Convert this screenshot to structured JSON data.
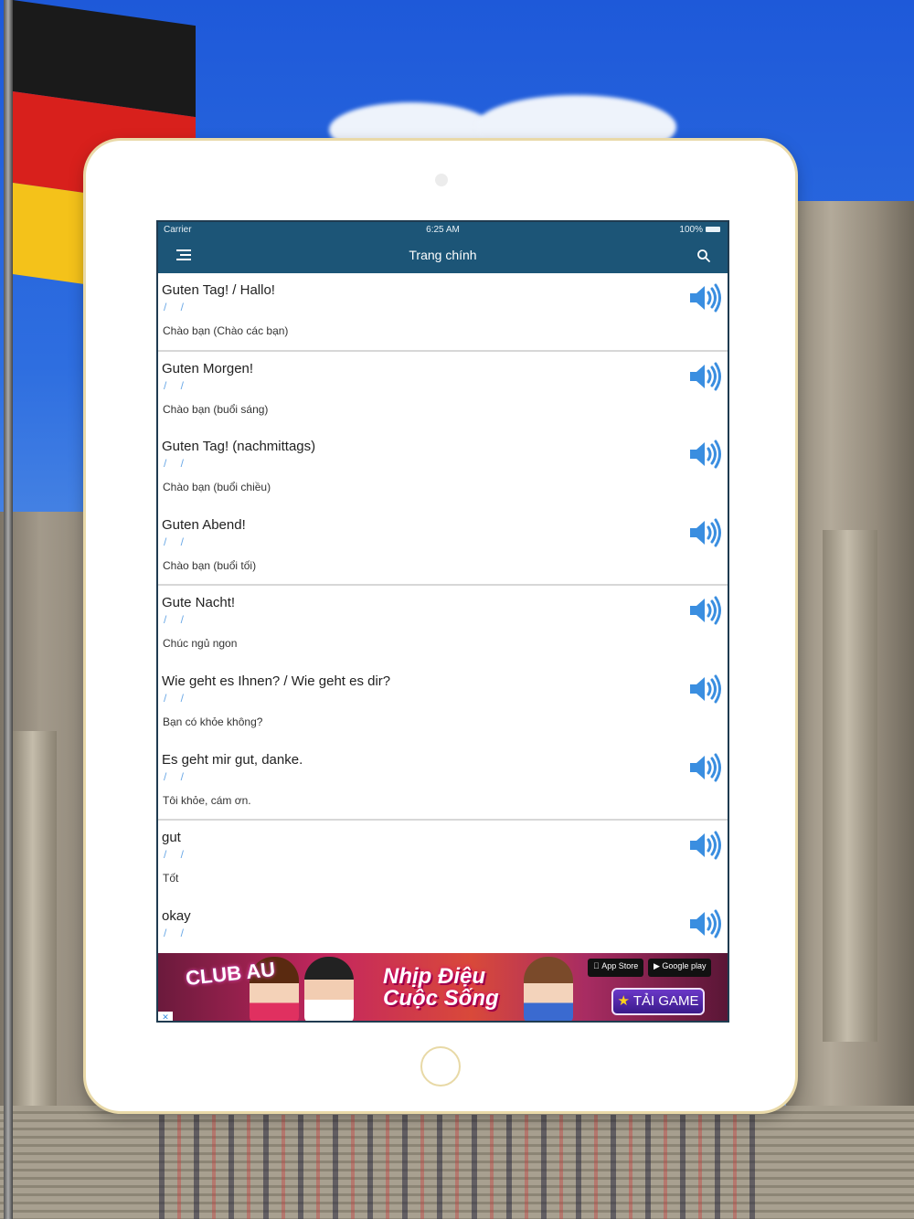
{
  "status_bar": {
    "carrier": "Carrier",
    "time": "6:25 AM",
    "battery": "100%"
  },
  "nav": {
    "title": "Trang chính"
  },
  "phrases": [
    {
      "german": "Guten Tag! / Hallo!",
      "phonetic": "/ /",
      "meaning": "Chào bạn (Chào các bạn)"
    },
    {
      "german": "Guten Morgen!",
      "phonetic": "/ /",
      "meaning": "Chào bạn (buổi sáng)"
    },
    {
      "german": "Guten Tag! (nachmittags)",
      "phonetic": "/ /",
      "meaning": "Chào bạn (buổi chiều)"
    },
    {
      "german": "Guten Abend!",
      "phonetic": "/ /",
      "meaning": "Chào bạn (buổi tối)"
    },
    {
      "german": "Gute Nacht!",
      "phonetic": "/ /",
      "meaning": "Chúc ngủ ngon"
    },
    {
      "german": "Wie geht es Ihnen? / Wie geht es dir?",
      "phonetic": "/ /",
      "meaning": "Bạn có khỏe không?"
    },
    {
      "german": "Es geht mir gut, danke.",
      "phonetic": "/ /",
      "meaning": "Tôi khỏe, cám ơn."
    },
    {
      "german": "gut",
      "phonetic": "/ /",
      "meaning": "Tốt"
    },
    {
      "german": "okay",
      "phonetic": "/ /",
      "meaning": ""
    }
  ],
  "ad": {
    "logo": "CLUB AU",
    "slogan": "Nhịp Điệu Cuộc Sống",
    "app_store": "App Store",
    "google_play": "Google play",
    "cta": "TẢI GAME"
  },
  "colors": {
    "nav_bg": "#1c5577",
    "speaker": "#3a8ee0",
    "phonetic": "#6aa8e6"
  }
}
